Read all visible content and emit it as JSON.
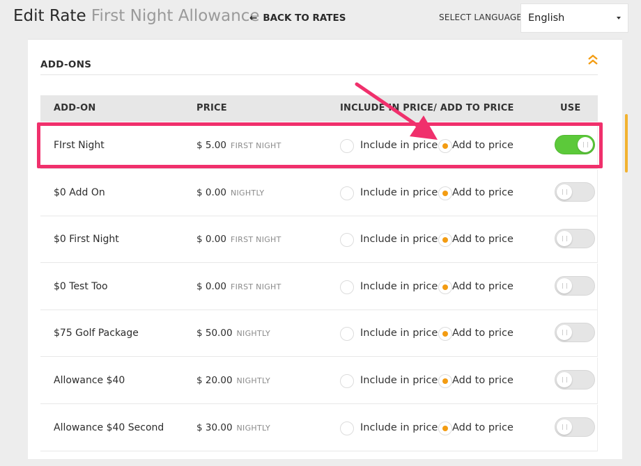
{
  "header": {
    "title": "Edit Rate",
    "subtitle": "First Night Allowance",
    "back_label": "BACK TO RATES",
    "language_label": "SELECT LANGUAGE",
    "language_value": "English"
  },
  "section": {
    "title": "ADD-ONS"
  },
  "table": {
    "columns": [
      "ADD-ON",
      "PRICE",
      "INCLUDE IN PRICE/ ADD TO PRICE",
      "USE"
    ],
    "include_label": "Include in price",
    "add_label": "Add to price",
    "rows": [
      {
        "name": "FIrst Night",
        "price": "$ 5.00",
        "frequency": "FIRST NIGHT",
        "mode": "add",
        "use": true
      },
      {
        "name": "$0 Add On",
        "price": "$ 0.00",
        "frequency": "NIGHTLY",
        "mode": "add",
        "use": false
      },
      {
        "name": "$0 First Night",
        "price": "$ 0.00",
        "frequency": "FIRST NIGHT",
        "mode": "add",
        "use": false
      },
      {
        "name": "$0 Test Too",
        "price": "$ 0.00",
        "frequency": "FIRST NIGHT",
        "mode": "add",
        "use": false
      },
      {
        "name": "$75 Golf Package",
        "price": "$ 50.00",
        "frequency": "NIGHTLY",
        "mode": "add",
        "use": false
      },
      {
        "name": "Allowance $40",
        "price": "$ 20.00",
        "frequency": "NIGHTLY",
        "mode": "add",
        "use": false
      },
      {
        "name": "Allowance $40 Second",
        "price": "$ 30.00",
        "frequency": "NIGHTLY",
        "mode": "add",
        "use": false
      }
    ]
  },
  "colors": {
    "accent": "#f39c12",
    "toggle_on": "#5cc93a",
    "annotation": "#f0306c",
    "scrollbar": "#f2b230"
  },
  "icons": {
    "back": "arrow-left-icon",
    "collapse": "double-chevron-up-icon",
    "select": "caret-down-icon"
  }
}
